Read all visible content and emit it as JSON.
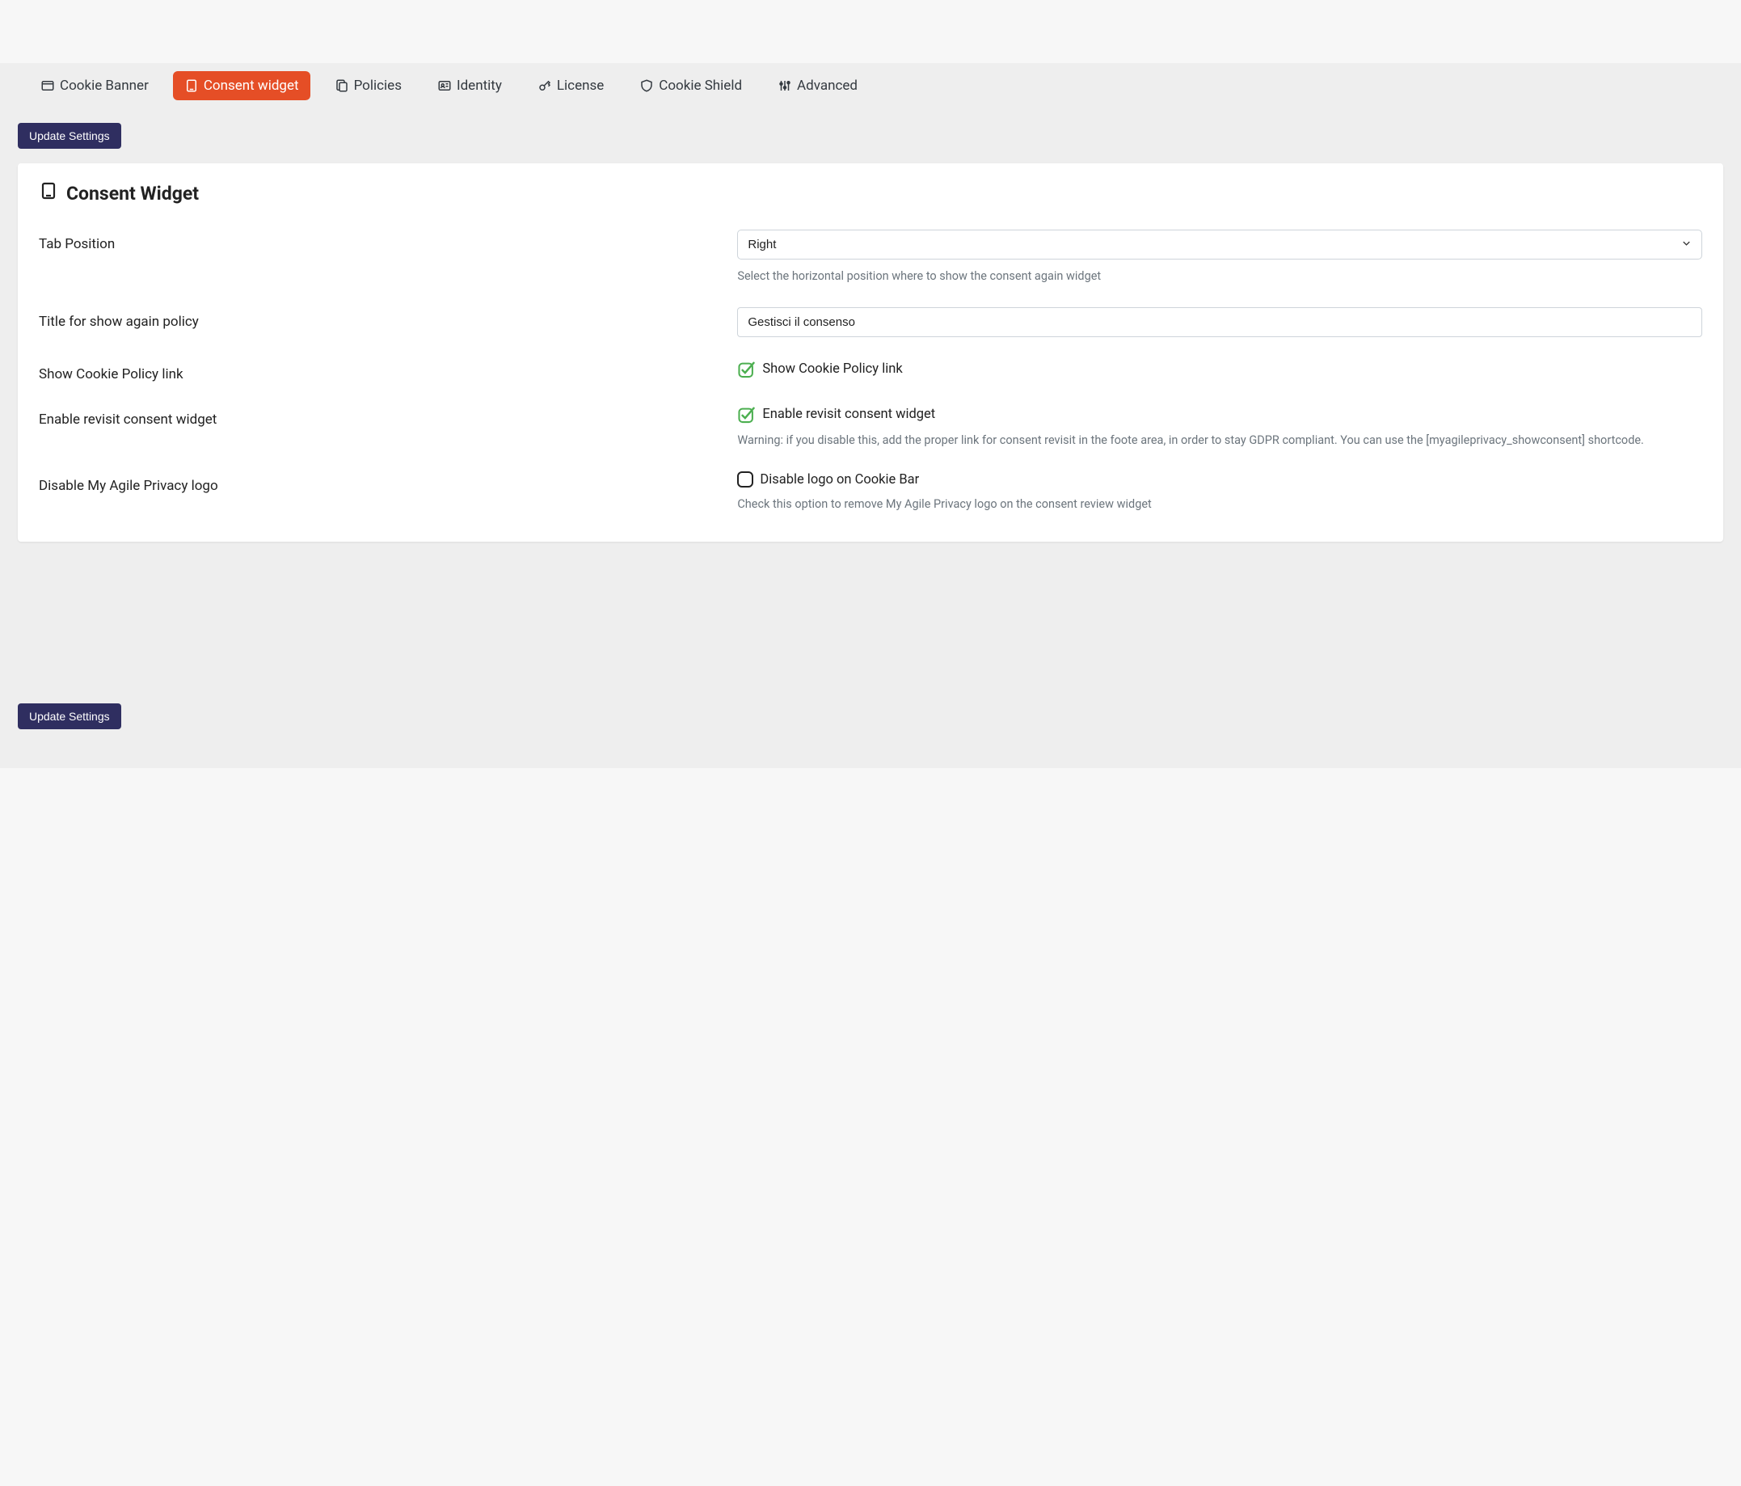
{
  "tabs": {
    "cookie_banner": "Cookie Banner",
    "consent_widget": "Consent widget",
    "policies": "Policies",
    "identity": "Identity",
    "license": "License",
    "cookie_shield": "Cookie Shield",
    "advanced": "Advanced"
  },
  "buttons": {
    "update_settings": "Update Settings"
  },
  "card": {
    "title": "Consent Widget"
  },
  "fields": {
    "tab_position": {
      "label": "Tab Position",
      "value": "Right",
      "helper": "Select the horizontal position where to show the consent again widget"
    },
    "title_show_again": {
      "label": "Title for show again policy",
      "value": "Gestisci il consenso"
    },
    "show_cookie_link": {
      "label": "Show Cookie Policy link",
      "check_label": "Show Cookie Policy link",
      "checked": true
    },
    "enable_revisit": {
      "label": "Enable revisit consent widget",
      "check_label": "Enable revisit consent widget",
      "checked": true,
      "helper": "Warning: if you disable this, add the proper link for consent revisit in the foote area, in order to stay GDPR compliant. You can use the [myagileprivacy_showconsent] shortcode."
    },
    "disable_logo": {
      "label": "Disable My Agile Privacy logo",
      "check_label": "Disable logo on Cookie Bar",
      "checked": false,
      "helper": "Check this option to remove My Agile Privacy logo on the consent review widget"
    }
  }
}
